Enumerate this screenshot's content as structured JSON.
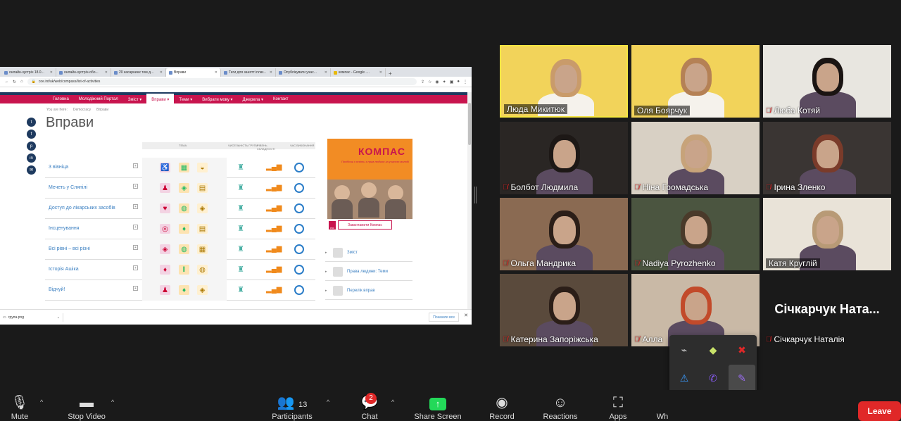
{
  "browser": {
    "tabs": [
      "онлайн-зустріч 18.0...",
      "онлайн-зустріч-обо...",
      "20 касарнинх тем д...",
      "Вправи",
      "Теги для занятті плаг...",
      "Опублікувати учас...",
      "компас - Google ...."
    ],
    "active_tab": 3,
    "url": "coe.int/uk/web/compass/list-of-activities",
    "nav": [
      "Головна",
      "Молодіжний Портал",
      "Зміст ▾",
      "Вправи ▾",
      "Теми ▾",
      "Вибрати мову ▾",
      "Джерела ▾",
      "Контакт"
    ],
    "breadcrumb": [
      "You are here:",
      "Democracy",
      "Вправи"
    ],
    "page_title": "Вправи",
    "table_headers": {
      "theme": "ТЕМА",
      "group": "ЧИСЕЛЬНІСТЬ ГРУПИ",
      "level": "РІВЕНЬ СКЛАДНОСТІ",
      "time": "ЧАС ВИКОНАННЯ"
    },
    "activities": [
      "3 вівніца",
      "Мечеть у Сляпілі",
      "Доступ до лікарських засобів",
      "Інсценування",
      "Всі рівні – всі різні",
      "Історія Ашіка",
      "Відчуй!"
    ],
    "book": {
      "title": "КОМПАС",
      "subtitle": "Посібник з освіти з прав людини за участю молоді",
      "download": "Завантажити Компас"
    },
    "sidebar_links": [
      "Зміст",
      "Права людини: Теми",
      "Перелік вправ"
    ],
    "download_file": "група.png",
    "show_all": "Показати все"
  },
  "participants": [
    {
      "name": "Люда Микитюк",
      "muted": false
    },
    {
      "name": "Оля Боярчук",
      "muted": false
    },
    {
      "name": "Люба Котяй",
      "muted": true
    },
    {
      "name": "Болбот Людмила",
      "muted": true
    },
    {
      "name": "Ніна Громадська",
      "muted": true
    },
    {
      "name": "Ірина Зленко",
      "muted": true
    },
    {
      "name": "Ольга Мандрика",
      "muted": true
    },
    {
      "name": "Nadiya Pyrozhenko",
      "muted": true
    },
    {
      "name": "Катя Круглій",
      "muted": false
    },
    {
      "name": "Катерина Запоріжська",
      "muted": true
    },
    {
      "name": "Алла",
      "muted": true
    },
    {
      "name": "Січкарчук Наталія",
      "muted": true
    }
  ],
  "placeholder_name": "Січкарчук  Ната...",
  "toolbar": {
    "mute": "Mute",
    "video": "Stop Video",
    "participants": "Participants",
    "participants_count": "13",
    "chat": "Chat",
    "chat_badge": "2",
    "share": "Share Screen",
    "record": "Record",
    "reactions": "Reactions",
    "apps": "Apps",
    "whiteboards": "Wh",
    "leave": "Leave"
  },
  "colors": {
    "brand": "#c8144e",
    "nav_dark": "#1e3a5f",
    "zoom_green": "#23d959",
    "leave_red": "#e02828",
    "active_speaker": "#f5e642"
  }
}
